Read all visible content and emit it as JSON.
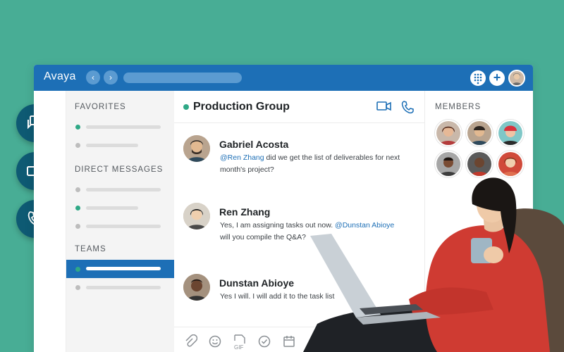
{
  "app": {
    "name": "Avaya",
    "nav_back_icon": "chevron-left-icon",
    "nav_forward_icon": "chevron-right-icon",
    "dialpad_icon": "dialpad-icon",
    "add_icon": "plus-icon"
  },
  "sidebar": {
    "favorites_label": "FAVORITES",
    "direct_messages_label": "DIRECT MESSAGES",
    "teams_label": "TEAMS"
  },
  "chat": {
    "title": "Production Group",
    "header_icons": [
      "video-icon",
      "phone-icon"
    ],
    "messages": [
      {
        "name": "Gabriel Acosta",
        "mention": "@Ren Zhang",
        "text": " did we get the list of deliverables for next month's project?"
      },
      {
        "name": "Ren Zhang",
        "text_before": "Yes, I am assigning tasks out now. ",
        "mention": "@Dunstan Abioye",
        "text_after": " will you compile the Q&A?"
      },
      {
        "name": "Dunstan Abioye",
        "text": "Yes I will. I will add it to the task list"
      }
    ],
    "composer_icons": [
      "attach-icon",
      "emoji-icon",
      "gif-icon",
      "check-icon",
      "calendar-icon"
    ]
  },
  "members": {
    "label": "MEMBERS"
  },
  "fabs": [
    "chat-icon",
    "video-icon",
    "phone-icon"
  ],
  "colors": {
    "background": "#48ad95",
    "titlebar": "#1d6fb6",
    "fab": "#0e5a73",
    "presence": "#2fa886"
  }
}
